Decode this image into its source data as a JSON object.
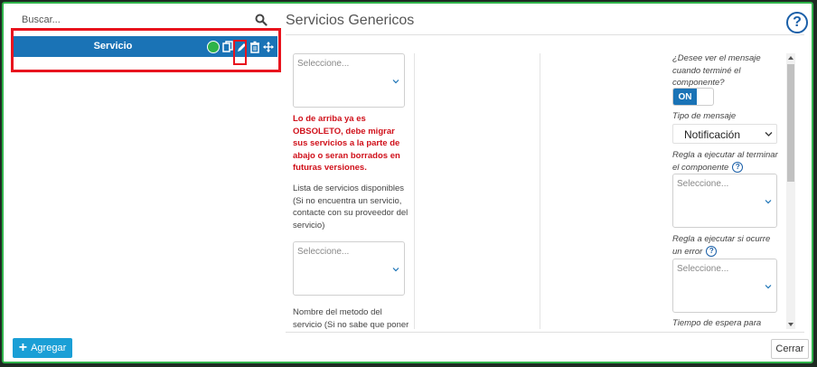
{
  "search": {
    "placeholder": "Buscar..."
  },
  "list": {
    "items": [
      {
        "label": "Servicio"
      }
    ]
  },
  "add_button": {
    "label": "Agregar"
  },
  "title": "Servicios Genericos",
  "form": {
    "select_placeholder": "Seleccione...",
    "warning": "Lo de arriba ya es OBSOLETO, debe migrar sus servicios a la parte de abajo o seran borrados en futuras versiones.",
    "services_label": "Lista de servicios disponibles (Si no encuentra un servicio, contacte con su proveedor del servicio)",
    "method_label": "Nombre del metodo del servicio (Si no sabe que poner",
    "show_message_label": "¿Desee ver el mensaje cuando terminé el componente?",
    "toggle_on": "ON",
    "message_type_label": "Tipo de mensaje",
    "message_type_value": "Notificación",
    "rule_finish_label": "Regla a ejecutar al terminar el componente",
    "rule_error_label": "Regla a ejecutar si ocurre un error",
    "wait_time_label": "Tiempo de espera para"
  },
  "help_symbol": "?",
  "close_button": {
    "label": "Cerrar"
  },
  "colors": {
    "accent": "#1a73b6",
    "highlight": "#e8141e",
    "warning": "#d0101a",
    "border": "#2fb34a"
  }
}
